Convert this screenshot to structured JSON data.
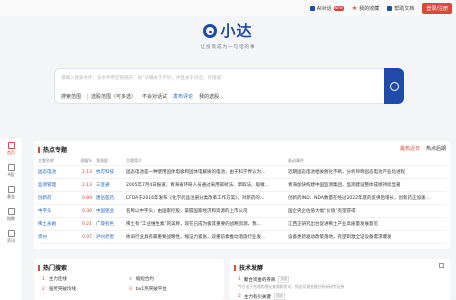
{
  "topbar": {
    "ai_label": "AI对话",
    "ai_badge": "NEW",
    "fav_label": "我的收藏",
    "help_label": "帮助文档",
    "login_label": "登录/注册"
  },
  "logo": {
    "brand": "小达",
    "slogan": "让投资成为一句话的事"
  },
  "search": {
    "placeholder": "请输入搜索条件，多条件用空格隔开，如“涉嫌关于不好，并且关于对话，存储器”",
    "scope_label": "搜索范围",
    "scope_value": "选股范围（可多选）",
    "option_label": "不会对话试",
    "option_link": "发布评论",
    "reports_label": "我的选股"
  },
  "sidebar": [
    {
      "label": "首页",
      "icon": "home-icon",
      "active": true
    },
    {
      "label": "A股",
      "icon": "chart-icon",
      "active": false
    },
    {
      "label": "基金",
      "icon": "fund-icon",
      "active": false
    },
    {
      "label": "指数",
      "icon": "index-icon",
      "active": false
    },
    {
      "label": "资讯",
      "icon": "news-icon",
      "active": false
    }
  ],
  "hot": {
    "title": "热点专题",
    "tabs": [
      "最热近日",
      "热点后期"
    ],
    "headers": [
      "主题名称",
      "涨幅%",
      "领涨股",
      "主题简介",
      "驱动事件"
    ],
    "rows": [
      {
        "name": "固态电池",
        "pct": "2.13",
        "lead": "杭可科技",
        "desc": "固态电池是一种使用固体电极和固体电解质的电池，由于科学界认为…",
        "event": "近期固态电池相关催化不断，分析师称固态电池产业化进程"
      },
      {
        "name": "监测管理",
        "pct": "2.13",
        "lead": "三变通",
        "desc": "2005年7月4日报道，青海省环研人员通过采用碳射法、草取法、吸做…",
        "event": "青海加快构建中国监测集团，监测建设整体成绩持续显著"
      },
      {
        "name": "创新药",
        "pct": "0.89",
        "lead": "唐岳医药",
        "desc": "CFDA于2016年发布《化学药品注册分类改革工作方案》，对新药的…",
        "event": "创新药IND、NDA数量在经过2022年底的反弹后增长，创新药正加速…"
      },
      {
        "name": "中字头",
        "pct": "0.30",
        "lead": "中国铝业",
        "desc": "名称以中字头，由国家控股，掌握国家经济和资源的上市公司",
        "event": "国企央企估值大幅“价值”有望获得"
      },
      {
        "name": "稀土永磁",
        "pct": "0.21",
        "lead": "广晟有色",
        "desc": "稀土有“工业维生素”的美称，现在已成为极其重要的战略资源，我…",
        "event": "江西正研究出台促进稀土产业高质量发展意见"
      },
      {
        "name": "贵州",
        "pct": "0.07",
        "lead": "泸州老窖",
        "desc": "依旧行业具有最重要战略性，缩证力紧张，双重前素推动酒旅行业发…",
        "event": "设备更新驱动政策落地，有望刺激全证设备需求爆发"
      }
    ]
  },
  "hot_search": {
    "title": "热门搜索",
    "items": [
      {
        "rank": "1",
        "text": "主力连线"
      },
      {
        "rank": "2",
        "text": "强势突破均线"
      },
      {
        "rank": "3",
        "text": "bx1热突破平台"
      },
      {
        "rank": "4",
        "text": "缩短合约"
      }
    ]
  },
  "tech_feed": {
    "title": "技术发酵",
    "items": [
      {
        "rank": "1",
        "title": "聚合资金的券商",
        "tag": "选股",
        "sub": "今日出于合理的理论来源和资讯，指出可观金融分析研研究证券"
      },
      {
        "rank": "2",
        "title": "主力有引关键",
        "tag": "选股",
        "sub": ""
      }
    ]
  }
}
